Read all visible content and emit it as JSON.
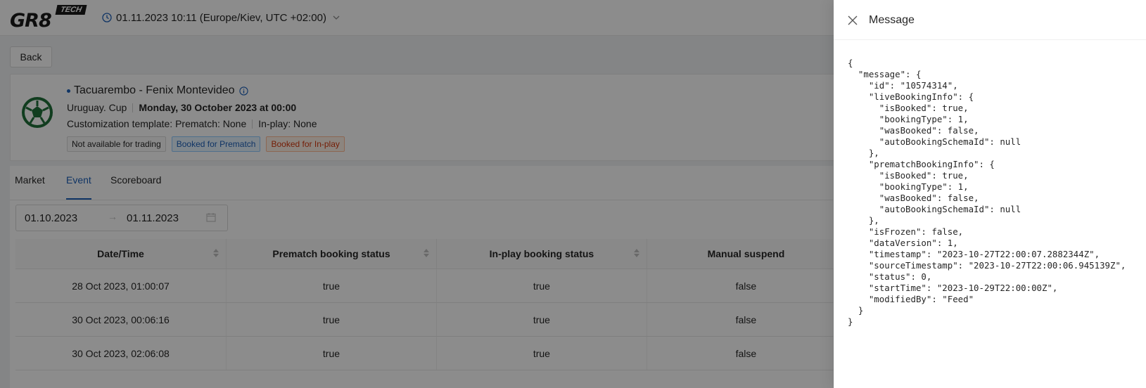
{
  "header": {
    "logo_text": "GR8",
    "logo_badge": "TECH",
    "datetime": "01.11.2023 10:11 (Europe/Kiev, UTC +02:00)"
  },
  "back_label": "Back",
  "event": {
    "title": "Tacuarembo - Fenix Montevideo",
    "tournament": "Uruguay. Cup",
    "date": "Monday, 30 October 2023 at 00:00",
    "customization": "Customization template: Prematch: None",
    "inplay": "In-play: None",
    "tags": [
      "Not available for trading",
      "Booked for Prematch",
      "Booked for In-play"
    ]
  },
  "tabs": [
    "Market",
    "Event",
    "Scoreboard"
  ],
  "date_range": {
    "from": "01.10.2023",
    "to": "01.11.2023"
  },
  "table": {
    "columns": [
      "Date/Time",
      "Prematch booking status",
      "In-play booking status",
      "Manual suspend"
    ],
    "rows": [
      [
        "28 Oct 2023, 01:00:07",
        "true",
        "true",
        "false"
      ],
      [
        "30 Oct 2023, 00:06:16",
        "true",
        "true",
        "false"
      ],
      [
        "30 Oct 2023, 02:06:08",
        "true",
        "true",
        "false"
      ]
    ]
  },
  "drawer": {
    "title": "Message",
    "json_lines": [
      "{",
      "  \"message\": {",
      "    \"id\": \"10574314\",",
      "    \"liveBookingInfo\": {",
      "      \"isBooked\": true,",
      "      \"bookingType\": 1,",
      "      \"wasBooked\": false,",
      "      \"autoBookingSchemaId\": null",
      "    },",
      "    \"prematchBookingInfo\": {",
      "      \"isBooked\": true,",
      "      \"bookingType\": 1,",
      "      \"wasBooked\": false,",
      "      \"autoBookingSchemaId\": null",
      "    },",
      "    \"isFrozen\": false,",
      "    \"dataVersion\": 1,",
      "    \"timestamp\": \"2023-10-27T22:00:07.2882344Z\",",
      "    \"sourceTimestamp\": \"2023-10-27T22:00:06.945139Z\",",
      "    \"status\": 0,",
      "    \"startTime\": \"2023-10-29T22:00:00Z\",",
      "    \"modifiedBy\": \"Feed\"",
      "  }",
      "}"
    ]
  },
  "colors": {
    "accent": "#1d5fb8",
    "ball": "#1f6f3a",
    "overlay": "rgba(0,0,0,0.45)"
  }
}
